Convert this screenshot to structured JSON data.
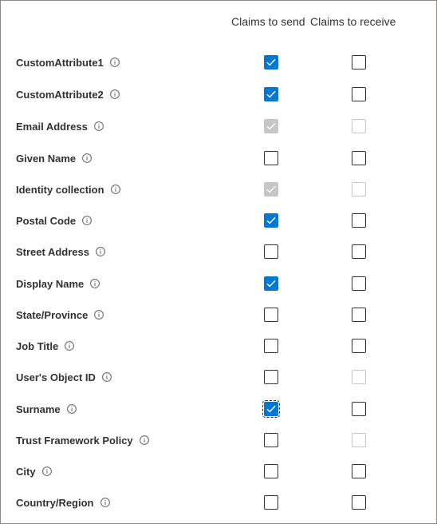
{
  "columns": {
    "send_label": "Claims to send",
    "receive_label": "Claims to receive"
  },
  "info_icon": "info-circle-icon",
  "colors": {
    "checked": "#0078d4",
    "disabled": "#c8c6c4",
    "border": "#323130"
  },
  "claims": [
    {
      "label": "CustomAttribute1",
      "send": "checked",
      "receive": "unchecked"
    },
    {
      "label": "CustomAttribute2",
      "send": "checked",
      "receive": "unchecked"
    },
    {
      "label": "Email Address",
      "send": "disabled-checked",
      "receive": "disabled"
    },
    {
      "label": "Given Name",
      "send": "unchecked",
      "receive": "unchecked"
    },
    {
      "label": "Identity collection",
      "send": "disabled-checked",
      "receive": "disabled"
    },
    {
      "label": "Postal Code",
      "send": "checked",
      "receive": "unchecked"
    },
    {
      "label": "Street Address",
      "send": "unchecked",
      "receive": "unchecked"
    },
    {
      "label": "Display Name",
      "send": "checked",
      "receive": "unchecked"
    },
    {
      "label": "State/Province",
      "send": "unchecked",
      "receive": "unchecked"
    },
    {
      "label": "Job Title",
      "send": "unchecked",
      "receive": "unchecked"
    },
    {
      "label": "User's Object ID",
      "send": "unchecked",
      "receive": "disabled"
    },
    {
      "label": "Surname",
      "send": "checked-focused",
      "receive": "unchecked"
    },
    {
      "label": "Trust Framework Policy",
      "send": "unchecked",
      "receive": "disabled"
    },
    {
      "label": "City",
      "send": "unchecked",
      "receive": "unchecked"
    },
    {
      "label": "Country/Region",
      "send": "unchecked",
      "receive": "unchecked"
    }
  ]
}
